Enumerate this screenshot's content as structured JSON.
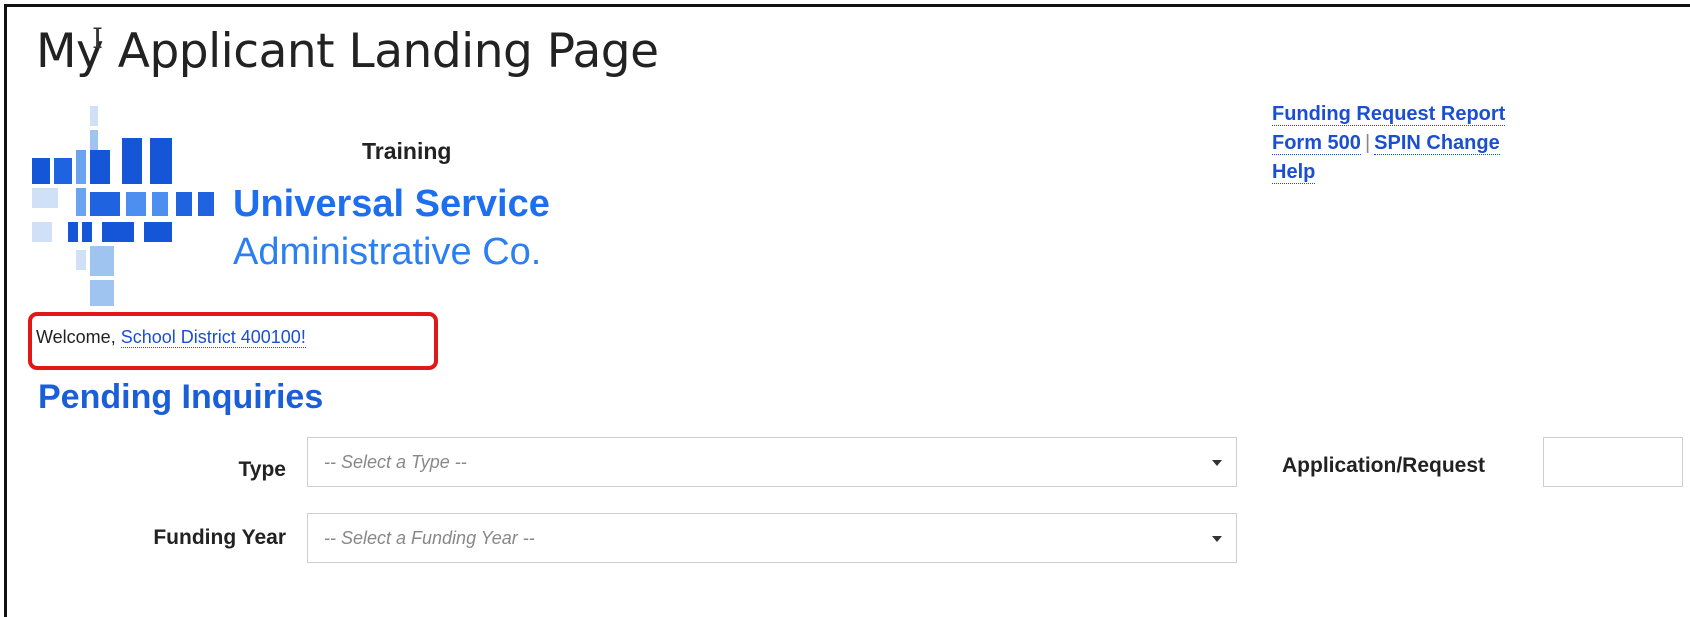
{
  "page": {
    "title": "My Applicant Landing Page"
  },
  "logo": {
    "training": "Training",
    "name_line1": "Universal Service",
    "name_line2": "Administrative Co."
  },
  "top_links": {
    "funding_request_report": "Funding Request Report",
    "form_500": "Form 500",
    "separator": "|",
    "spin_change": "SPIN Change",
    "help": "Help"
  },
  "welcome": {
    "prefix": "Welcome,",
    "entity": "School District 400100!"
  },
  "pending_inquiries": {
    "title": "Pending Inquiries",
    "type_label": "Type",
    "type_placeholder": "-- Select a Type --",
    "funding_year_label": "Funding Year",
    "funding_year_placeholder": "-- Select a Funding Year --",
    "application_request_label": "Application/Request"
  },
  "colors": {
    "link": "#1a4fd1",
    "brand_blue": "#1d6ff0",
    "highlight_red": "#e01818"
  }
}
